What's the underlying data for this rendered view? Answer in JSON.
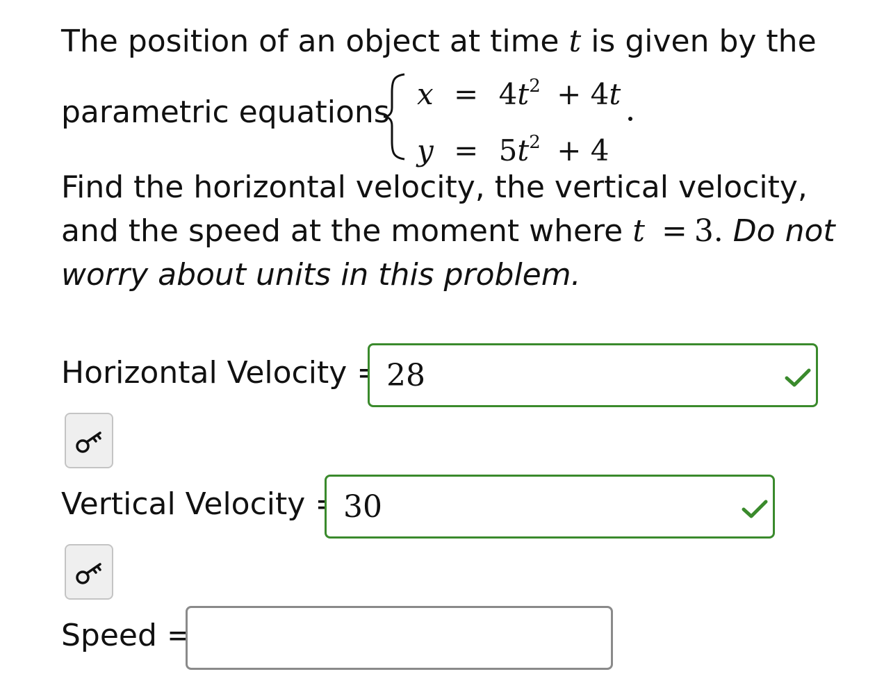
{
  "problem": {
    "intro_before": "The position of an object at time",
    "intro_var": "t",
    "intro_after": "is given by the",
    "parametric_label": "parametric equations",
    "eq_x_var": "x",
    "eq_x_equals": "=",
    "eq_x_coef": "4",
    "eq_x_var_t": "t",
    "eq_x_exp": "2",
    "eq_x_rest": "+ 4",
    "eq_x_rest_var": "t",
    "eq_y_var": "y",
    "eq_y_equals": "=",
    "eq_y_coef": "5",
    "eq_y_var_t": "t",
    "eq_y_exp": "2",
    "eq_y_rest": "+ 4",
    "find_line": "Find the horizontal velocity, the vertical velocity,",
    "moment_before": "and the speed at the moment where",
    "moment_var": "t",
    "moment_equals": "=",
    "moment_value": "3.",
    "moment_italic": "Do not",
    "worry_line": "worry about units in this problem."
  },
  "answers": [
    {
      "label": "Horizontal Velocity =",
      "value": "28",
      "status": "correct"
    },
    {
      "label": "Vertical Velocity =",
      "value": "30",
      "status": "correct"
    },
    {
      "label": "Speed =",
      "value": "",
      "status": "empty"
    }
  ],
  "icons": {
    "check": "check-icon",
    "key": "key-icon"
  },
  "colors": {
    "correct_border": "#3a8a2c",
    "empty_border": "#8a8a8a",
    "key_button_bg": "#efefef"
  }
}
